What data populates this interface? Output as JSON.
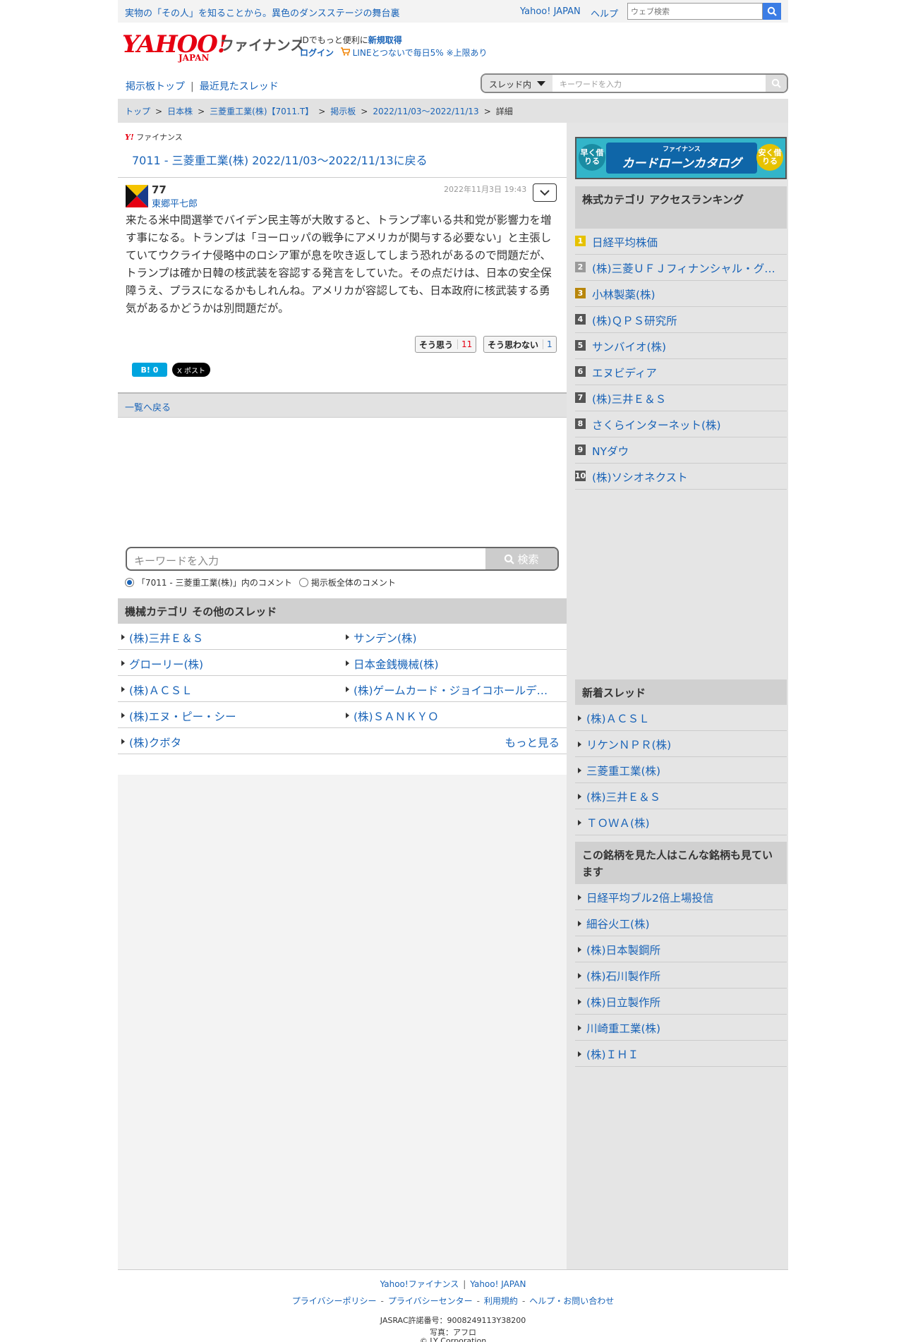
{
  "topbar": {
    "promo": "実物の「その人」を知ることから。異色のダンスステージの舞台裏",
    "yahoo_japan": "Yahoo! JAPAN",
    "help": "ヘルプ",
    "search_placeholder": "ウェブ検索"
  },
  "header": {
    "logo": "YAHOO!",
    "logo_sub": "JAPAN",
    "finance": "ファイナンス",
    "id_text": "IDでもっと便利に",
    "signup": "新規取得",
    "login": "ログイン",
    "line_promo": "LINEとつないで毎日5% ※上限あり"
  },
  "subnav": {
    "board_top": "掲示板トップ",
    "recent": "最近見たスレッド",
    "scope": "スレッド内",
    "keyword_placeholder": "キーワードを入力"
  },
  "breadcrumb": [
    "トップ",
    "日本株",
    "三菱重工業(株)【7011.T】",
    "掲示板",
    "2022/11/03〜2022/11/13",
    "詳細"
  ],
  "main": {
    "brand": "ファイナンス",
    "thread_title": "7011 - 三菱重工業(株) 2022/11/03〜2022/11/13に戻る",
    "post": {
      "number": "77",
      "author": "東郷平七郎",
      "date": "2022年11月3日 19:43",
      "body": "来たる米中間選挙でバイデン民主等が大敗すると、トランプ率いる共和党が影響力を増す事になる。トランプは「ヨーロッパの戦争にアメリカが関与する必要ない」と主張していてウクライナ侵略中のロシア軍が息を吹き返してしまう恐れがあるので問題だが、トランプは確か日韓の核武装を容認する発言をしていた。その点だけは、日本の安全保障うえ、プラスになるかもしれんね。アメリカが容認しても、日本政府に核武装する勇気があるかどうかは別問題だが。",
      "vote_yes_label": "そう思う",
      "vote_yes_count": "11",
      "vote_no_label": "そう思わない",
      "vote_no_count": "1",
      "hatena": "B! 0",
      "tweet": "X ポスト"
    },
    "back_to_list": "一覧へ戻る",
    "search": {
      "placeholder": "キーワードを入力",
      "button": "検索",
      "radio1": "「7011 - 三菱重工業(株)」内のコメント",
      "radio2": "掲示板全体のコメント"
    },
    "related_title": "機械カテゴリ その他のスレッド",
    "related_left": [
      "(株)三井Ｅ＆Ｓ",
      "グローリー(株)",
      "(株)ＡＣＳＬ",
      "(株)エヌ・ピー・シー",
      "(株)クボタ"
    ],
    "related_right": [
      "サンデン(株)",
      "日本金銭機械(株)",
      "(株)ゲームカード・ジョイコホールデ…",
      "(株)ＳＡＮＫＹＯ"
    ],
    "more": "もっと見る"
  },
  "side": {
    "banner_title": "ファイナンス",
    "banner_main": "カードローンカタログ",
    "banner_left": "早く借りる",
    "banner_right": "安く借りる",
    "ranking_title": "株式カテゴリ アクセスランキング",
    "ranking": [
      "日経平均株価",
      "(株)三菱ＵＦＪフィナンシャル・グ…",
      "小林製薬(株)",
      "(株)ＱＰＳ研究所",
      "サンバイオ(株)",
      "エヌビディア",
      "(株)三井Ｅ＆Ｓ",
      "さくらインターネット(株)",
      "NYダウ",
      "(株)ソシオネクスト"
    ],
    "new_threads_title": "新着スレッド",
    "new_threads": [
      "(株)ＡＣＳＬ",
      "リケンＮＰＲ(株)",
      "三菱重工業(株)",
      "(株)三井Ｅ＆Ｓ",
      "ＴＯＷＡ(株)"
    ],
    "also_viewed_title": "この銘柄を見た人はこんな銘柄も見ています",
    "also_viewed": [
      "日経平均ブル2倍上場投信",
      "細谷火工(株)",
      "(株)日本製鋼所",
      "(株)石川製作所",
      "(株)日立製作所",
      "川崎重工業(株)",
      "(株)ＩＨＩ"
    ]
  },
  "footer": {
    "finance": "Yahoo!ファイナンス",
    "yahoo_japan": "Yahoo! JAPAN",
    "privacy_policy": "プライバシーポリシー",
    "privacy_center": "プライバシーセンター",
    "terms": "利用規約",
    "help": "ヘルプ・お問い合わせ",
    "jasrac": "JASRAC許諾番号：9008249113Y38200",
    "photo": "写真：アフロ",
    "copyright": "© LY Corporation"
  }
}
